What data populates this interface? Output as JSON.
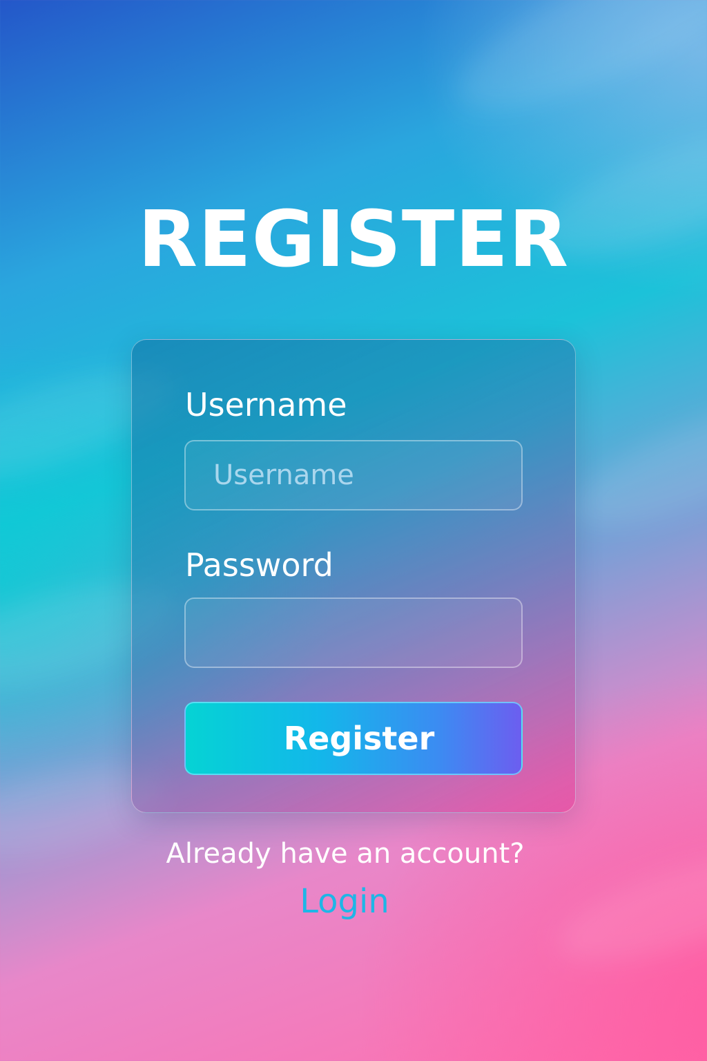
{
  "page": {
    "title": "REGISTER"
  },
  "form": {
    "username": {
      "label": "Username",
      "placeholder": "Username",
      "value": ""
    },
    "password": {
      "label": "Password",
      "placeholder": "",
      "value": ""
    },
    "submit_label": "Register"
  },
  "footer": {
    "prompt": "Already have an account?",
    "login_link": "Login"
  },
  "colors": {
    "title_text": "#ffffff",
    "login_link": "#1eb6e6",
    "button_gradient_start": "#05d3d4",
    "button_gradient_end": "#6c5ef0",
    "background_top_left": "#2457c9",
    "background_bottom_right": "#ff6fae"
  }
}
